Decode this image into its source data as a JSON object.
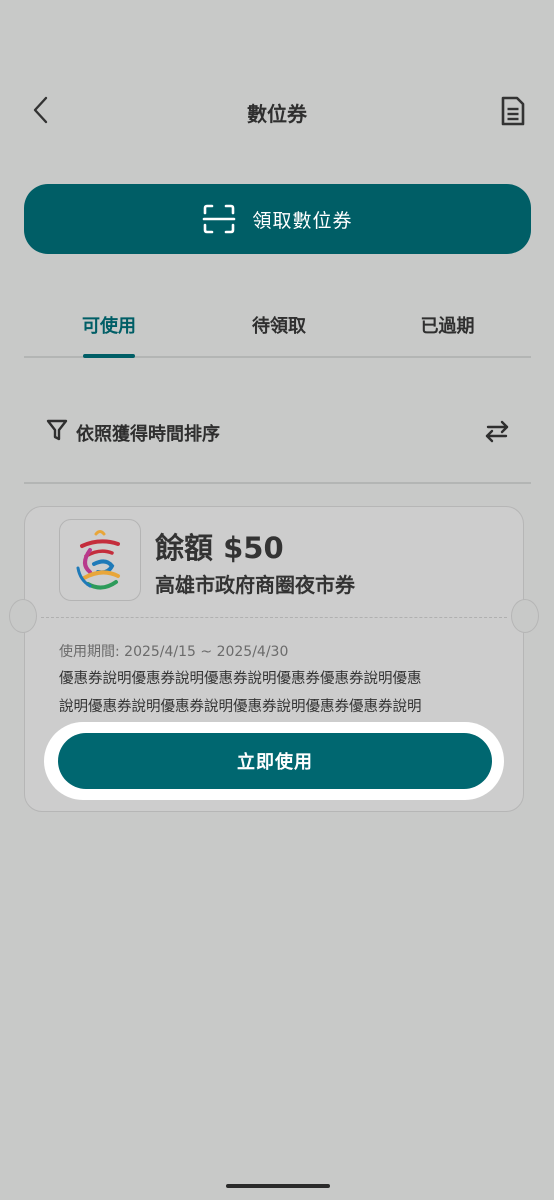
{
  "header": {
    "title": "數位券",
    "back_icon": "chevron-left-icon",
    "doc_icon": "document-icon"
  },
  "collect": {
    "label": "領取數位券",
    "icon": "scan-icon"
  },
  "tabs": [
    {
      "label": "可使用",
      "active": true
    },
    {
      "label": "待領取",
      "active": false
    },
    {
      "label": "已過期",
      "active": false
    }
  ],
  "sort": {
    "label": "依照獲得時間排序",
    "filter_icon": "filter-icon",
    "swap_icon": "swap-icon"
  },
  "coupon": {
    "balance": "餘額 $50",
    "name": "高雄市政府商圈夜市券",
    "validity": "使用期間: 2025/4/15 ~ 2025/4/30",
    "desc_line1": "優惠券說明優惠券說明優惠券說明優惠券優惠券說明優惠",
    "desc_line2": "說明優惠券說明優惠券說明優惠券說明優惠券優惠券說明",
    "use_label": "立即使用"
  },
  "colors": {
    "primary": "#005e66",
    "background": "#c8c9c8"
  }
}
